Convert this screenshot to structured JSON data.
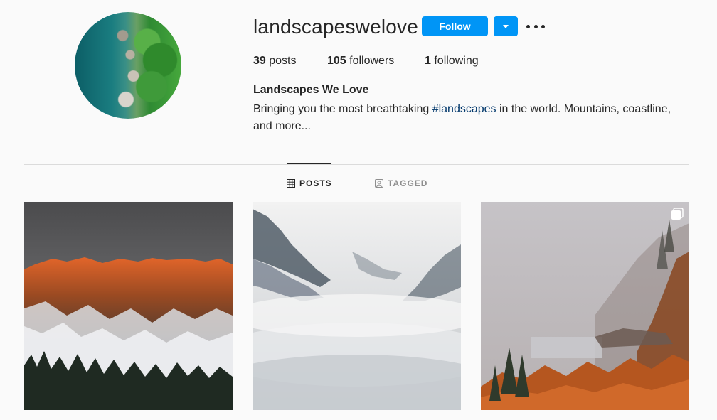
{
  "profile": {
    "username": "landscapeswelove",
    "full_name": "Landscapes We Love",
    "bio_before": "Bringing you the most breathtaking ",
    "bio_hashtag": "#landscapes",
    "bio_after": " in the world. Mountains, coastline, and more..."
  },
  "actions": {
    "follow_label": "Follow"
  },
  "stats": {
    "posts_count": "39",
    "posts_label": " posts",
    "followers_count": "105",
    "followers_label": " followers",
    "following_count": "1",
    "following_label": " following"
  },
  "tabs": [
    {
      "label": "POSTS",
      "icon": "grid-icon",
      "active": true
    },
    {
      "label": "TAGGED",
      "icon": "tagged-icon",
      "active": false
    }
  ],
  "posts": [
    {
      "subject": "snowy-mountain-sunset",
      "multiple": false
    },
    {
      "subject": "foggy-forest-valley",
      "multiple": false
    },
    {
      "subject": "autumn-fog-hillside",
      "multiple": true
    }
  ],
  "colors": {
    "accent": "#0095f6",
    "hashtag": "#00376b",
    "text": "#262626",
    "muted": "#8e8e8e",
    "background": "#fafafa",
    "divider": "#dbdbdb"
  }
}
